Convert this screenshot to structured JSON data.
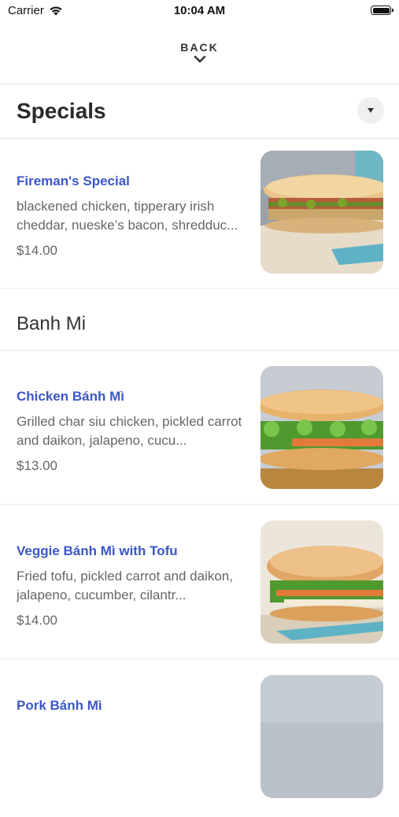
{
  "status_bar": {
    "carrier": "Carrier",
    "time": "10:04 AM"
  },
  "nav": {
    "back_label": "BACK"
  },
  "sections": {
    "specials": {
      "title": "Specials"
    },
    "banh_mi": {
      "title": "Banh Mi"
    }
  },
  "items": [
    {
      "name": "Fireman's Special",
      "description": "blackened chicken, tipperary irish cheddar, nueske’s bacon, shredduc...",
      "price": "$14.00"
    },
    {
      "name": "Chicken Bánh Mì",
      "description": "Grilled char siu chicken, pickled carrot and daikon, jalapeno, cucu...",
      "price": "$13.00"
    },
    {
      "name": "Veggie Bánh Mì with Tofu",
      "description": "Fried tofu, pickled carrot and daikon, jalapeno, cucumber, cilantr...",
      "price": "$14.00"
    },
    {
      "name": "Pork Bánh Mì",
      "description": "",
      "price": ""
    }
  ],
  "colors": {
    "accent": "#3b57c8",
    "divider": "#e8e8e8"
  },
  "icons": {
    "wifi": "wifi-icon",
    "battery": "battery-icon",
    "back": "chevron-down-icon",
    "dropdown": "triangle-down-icon"
  }
}
